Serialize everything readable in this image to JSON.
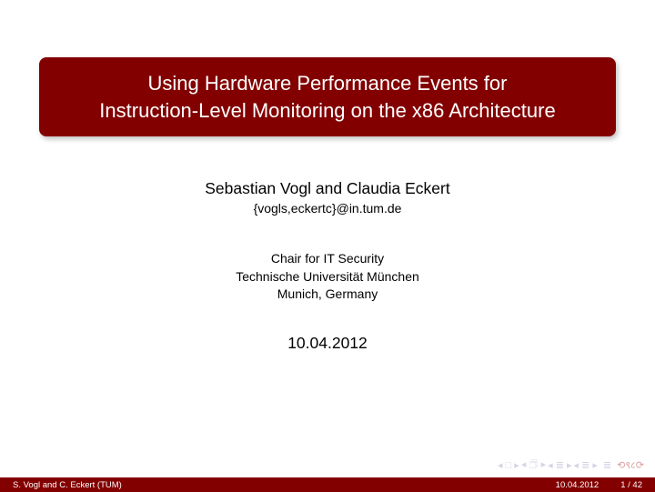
{
  "title": {
    "line1": "Using Hardware Performance Events for",
    "line2": "Instruction-Level Monitoring on the x86 Architecture"
  },
  "authors": "Sebastian Vogl and Claudia Eckert",
  "emails": "{vogls,eckertc}@in.tum.de",
  "affiliation": {
    "line1": "Chair for IT Security",
    "line2": "Technische Universität München",
    "line3": "Munich, Germany"
  },
  "date": "10.04.2012",
  "footer": {
    "left": "S. Vogl and C. Eckert (TUM)",
    "date": "10.04.2012",
    "page": "1 / 42"
  },
  "nav": {
    "first_prev": "◂ □ ▸",
    "section_prev": "◂ 🗇 ▸",
    "slide_prev": "◂ ≣ ▸",
    "slide_next": "◂ ≣ ▸",
    "goto": "≣",
    "undo": "⟲९८⟳"
  }
}
